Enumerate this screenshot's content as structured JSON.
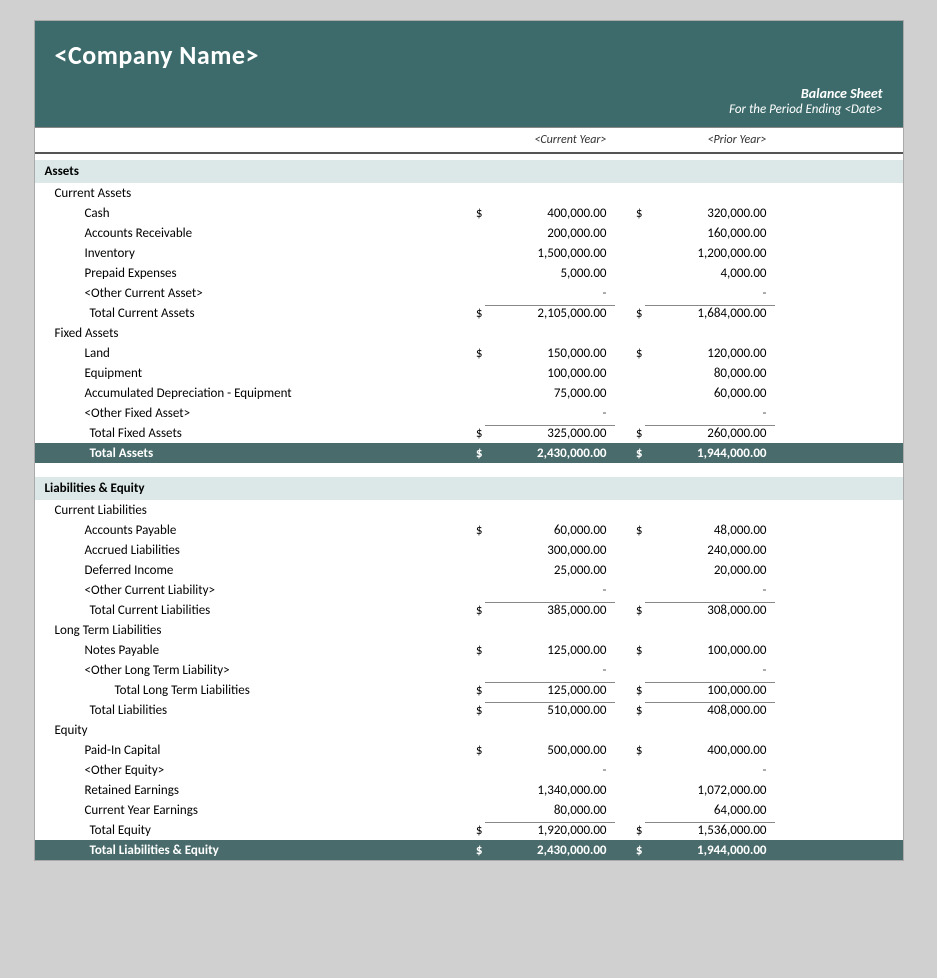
{
  "header": {
    "company_name": "<Company Name>",
    "report_title": "Balance Sheet",
    "report_subtitle": "For the Period Ending <Date>",
    "col_current_year": "<Current Year>",
    "col_prior_year": "<Prior Year>"
  },
  "assets": {
    "section_label": "Assets",
    "current_assets": {
      "label": "Current Assets",
      "items": [
        {
          "name": "Cash",
          "show_dollar": true,
          "cy": "400,000.00",
          "py_dollar": true,
          "py": "320,000.00"
        },
        {
          "name": "Accounts Receivable",
          "show_dollar": false,
          "cy": "200,000.00",
          "py_dollar": false,
          "py": "160,000.00"
        },
        {
          "name": "Inventory",
          "show_dollar": false,
          "cy": "1,500,000.00",
          "py_dollar": false,
          "py": "1,200,000.00"
        },
        {
          "name": "Prepaid Expenses",
          "show_dollar": false,
          "cy": "5,000.00",
          "py_dollar": false,
          "py": "4,000.00"
        },
        {
          "name": "<Other Current Asset>",
          "show_dollar": false,
          "cy": "-",
          "py_dollar": false,
          "py": "-"
        }
      ],
      "total_label": "Total Current Assets",
      "total_cy_dollar": true,
      "total_cy": "2,105,000.00",
      "total_py_dollar": true,
      "total_py": "1,684,000.00"
    },
    "fixed_assets": {
      "label": "Fixed Assets",
      "items": [
        {
          "name": "Land",
          "show_dollar": true,
          "cy": "150,000.00",
          "py_dollar": true,
          "py": "120,000.00"
        },
        {
          "name": "Equipment",
          "show_dollar": false,
          "cy": "100,000.00",
          "py_dollar": false,
          "py": "80,000.00"
        },
        {
          "name": "Accumulated Depreciation - Equipment",
          "show_dollar": false,
          "cy": "75,000.00",
          "py_dollar": false,
          "py": "60,000.00"
        },
        {
          "name": "<Other Fixed Asset>",
          "show_dollar": false,
          "cy": "-",
          "py_dollar": false,
          "py": "-"
        }
      ],
      "total_label": "Total Fixed Assets",
      "total_cy_dollar": true,
      "total_cy": "325,000.00",
      "total_py_dollar": true,
      "total_py": "260,000.00"
    },
    "grand_total_label": "Total Assets",
    "grand_total_cy_dollar": true,
    "grand_total_cy": "2,430,000.00",
    "grand_total_py_dollar": true,
    "grand_total_py": "1,944,000.00"
  },
  "liabilities_equity": {
    "section_label": "Liabilities & Equity",
    "current_liabilities": {
      "label": "Current Liabilities",
      "items": [
        {
          "name": "Accounts Payable",
          "show_dollar": true,
          "cy": "60,000.00",
          "py_dollar": true,
          "py": "48,000.00"
        },
        {
          "name": "Accrued Liabilities",
          "show_dollar": false,
          "cy": "300,000.00",
          "py_dollar": false,
          "py": "240,000.00"
        },
        {
          "name": "Deferred Income",
          "show_dollar": false,
          "cy": "25,000.00",
          "py_dollar": false,
          "py": "20,000.00"
        },
        {
          "name": "<Other Current Liability>",
          "show_dollar": false,
          "cy": "-",
          "py_dollar": false,
          "py": "-"
        }
      ],
      "total_label": "Total Current Liabilities",
      "total_cy_dollar": true,
      "total_cy": "385,000.00",
      "total_py_dollar": true,
      "total_py": "308,000.00"
    },
    "long_term_liabilities": {
      "label": "Long Term Liabilities",
      "items": [
        {
          "name": "Notes Payable",
          "show_dollar": true,
          "cy": "125,000.00",
          "py_dollar": true,
          "py": "100,000.00"
        },
        {
          "name": "<Other Long Term Liability>",
          "show_dollar": false,
          "cy": "-",
          "py_dollar": false,
          "py": "-"
        }
      ],
      "total_label": "Total Long Term Liabilities",
      "total_cy_dollar": true,
      "total_cy": "125,000.00",
      "total_py_dollar": true,
      "total_py": "100,000.00"
    },
    "total_liabilities_label": "Total Liabilities",
    "total_liabilities_cy_dollar": true,
    "total_liabilities_cy": "510,000.00",
    "total_liabilities_py_dollar": true,
    "total_liabilities_py": "408,000.00",
    "equity": {
      "label": "Equity",
      "items": [
        {
          "name": "Paid-In Capital",
          "show_dollar": true,
          "cy": "500,000.00",
          "py_dollar": true,
          "py": "400,000.00"
        },
        {
          "name": "<Other Equity>",
          "show_dollar": false,
          "cy": "-",
          "py_dollar": false,
          "py": "-"
        },
        {
          "name": "Retained Earnings",
          "show_dollar": false,
          "cy": "1,340,000.00",
          "py_dollar": false,
          "py": "1,072,000.00"
        },
        {
          "name": "Current Year Earnings",
          "show_dollar": false,
          "cy": "80,000.00",
          "py_dollar": false,
          "py": "64,000.00"
        }
      ],
      "total_label": "Total Equity",
      "total_cy_dollar": true,
      "total_cy": "1,920,000.00",
      "total_py_dollar": true,
      "total_py": "1,536,000.00"
    },
    "grand_total_label": "Total Liabilities & Equity",
    "grand_total_cy_dollar": true,
    "grand_total_cy": "2,430,000.00",
    "grand_total_py_dollar": true,
    "grand_total_py": "1,944,000.00"
  }
}
